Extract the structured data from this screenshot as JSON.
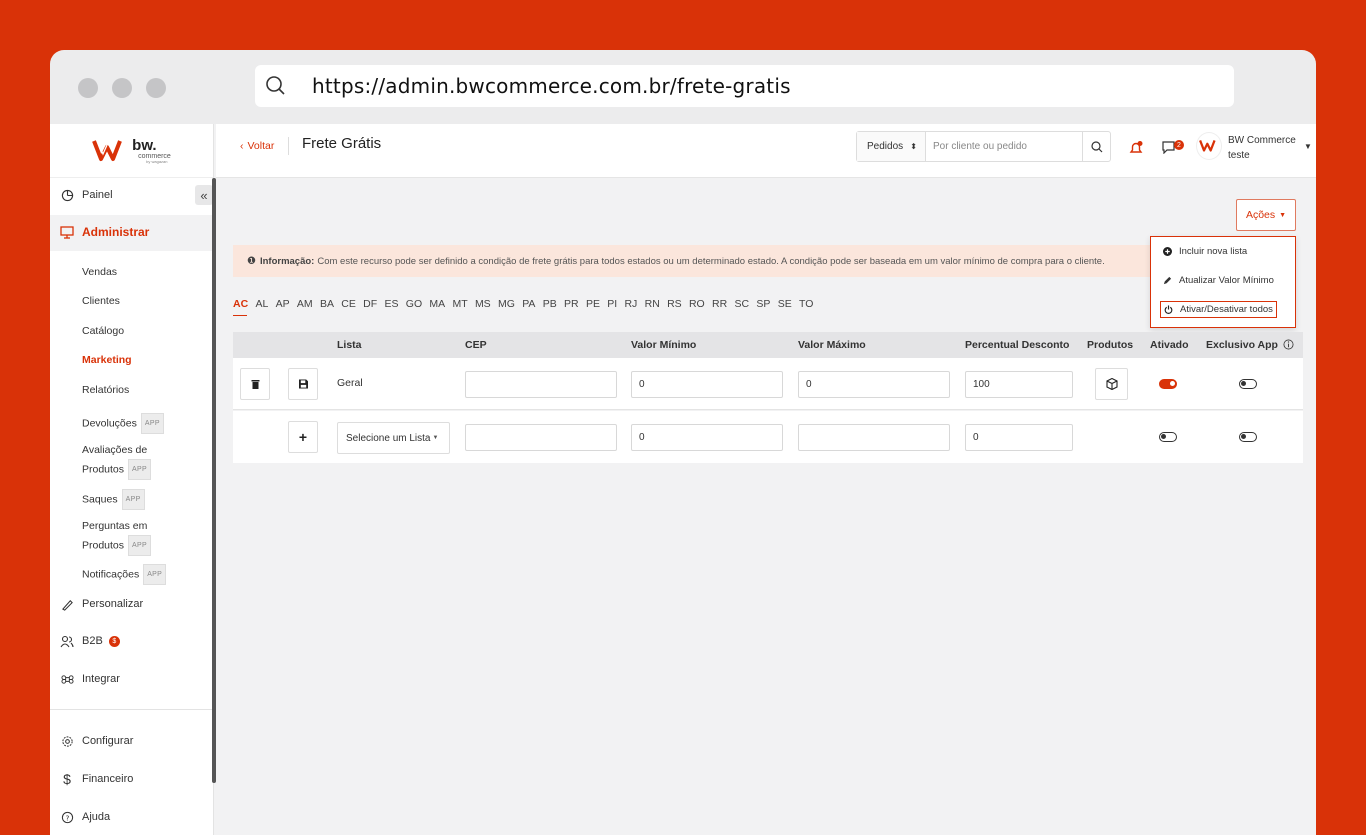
{
  "browser": {
    "url": "https://admin.bwcommerce.com.br/frete-gratis"
  },
  "logo": {
    "brand": "bw.",
    "sub": "commerce",
    "tiny": "by wagazan"
  },
  "sidebar": {
    "collapse_glyph": "«",
    "items": [
      {
        "label": "Painel",
        "icon": "clock-pie-icon"
      },
      {
        "label": "Administrar",
        "icon": "monitor-icon"
      },
      {
        "label": "Personalizar",
        "icon": "brush-icon"
      },
      {
        "label": "B2B",
        "icon": "users-icon",
        "badge": "$"
      },
      {
        "label": "Integrar",
        "icon": "command-icon"
      },
      {
        "label": "Configurar",
        "icon": "gear-icon"
      },
      {
        "label": "Financeiro",
        "icon": "dollar-icon"
      },
      {
        "label": "Ajuda",
        "icon": "help-icon"
      }
    ],
    "sub_items": [
      {
        "label": "Vendas"
      },
      {
        "label": "Clientes"
      },
      {
        "label": "Catálogo"
      },
      {
        "label": "Marketing"
      },
      {
        "label": "Relatórios"
      },
      {
        "label": "Devoluções",
        "tag": "APP"
      },
      {
        "label": "Avaliações de",
        "label2": "Produtos",
        "tag": "APP"
      },
      {
        "label": "Saques",
        "tag": "APP"
      },
      {
        "label": "Perguntas em",
        "label2": "Produtos",
        "tag": "APP"
      },
      {
        "label": "Notificações",
        "tag": "APP"
      }
    ]
  },
  "header": {
    "back_label": "Voltar",
    "title": "Frete Grátis",
    "search_type": "Pedidos",
    "search_placeholder": "Por cliente ou pedido",
    "chat_count": "2",
    "user_company": "BW Commerce",
    "user_name": "teste"
  },
  "actions": {
    "button_label": "Ações",
    "menu": [
      {
        "label": "Incluir nova lista",
        "icon": "plus-circle-icon"
      },
      {
        "label": "Atualizar Valor Mínimo",
        "icon": "pencil-icon"
      },
      {
        "label": "Ativar/Desativar todos",
        "icon": "power-icon"
      }
    ]
  },
  "info": {
    "title": "Informação:",
    "text": "Com este recurso pode ser definido a condição de frete grátis para todos estados ou um determinado estado. A condição pode ser baseada em um valor mínimo de compra para o cliente."
  },
  "states": [
    "AC",
    "AL",
    "AP",
    "AM",
    "BA",
    "CE",
    "DF",
    "ES",
    "GO",
    "MA",
    "MT",
    "MS",
    "MG",
    "PA",
    "PB",
    "PR",
    "PE",
    "PI",
    "RJ",
    "RN",
    "RS",
    "RO",
    "RR",
    "SC",
    "SP",
    "SE",
    "TO"
  ],
  "table": {
    "headers": {
      "lista": "Lista",
      "cep": "CEP",
      "valor_minimo": "Valor Mínimo",
      "valor_maximo": "Valor Máximo",
      "percentual": "Percentual Desconto",
      "produtos": "Produtos",
      "ativado": "Ativado",
      "exclusivo": "Exclusivo App"
    },
    "rows": [
      {
        "lista": "Geral",
        "cep": "",
        "valor_minimo": "0",
        "valor_maximo": "0",
        "percentual": "100",
        "ativado": true,
        "exclusivo": false
      },
      {
        "lista_placeholder": "Selecione um Lista",
        "cep": "",
        "valor_minimo": "0",
        "valor_maximo": "",
        "percentual": "0",
        "ativado": false,
        "exclusivo": false
      }
    ]
  },
  "colors": {
    "brand": "#d93208",
    "info_bg": "#fbe6dc"
  }
}
